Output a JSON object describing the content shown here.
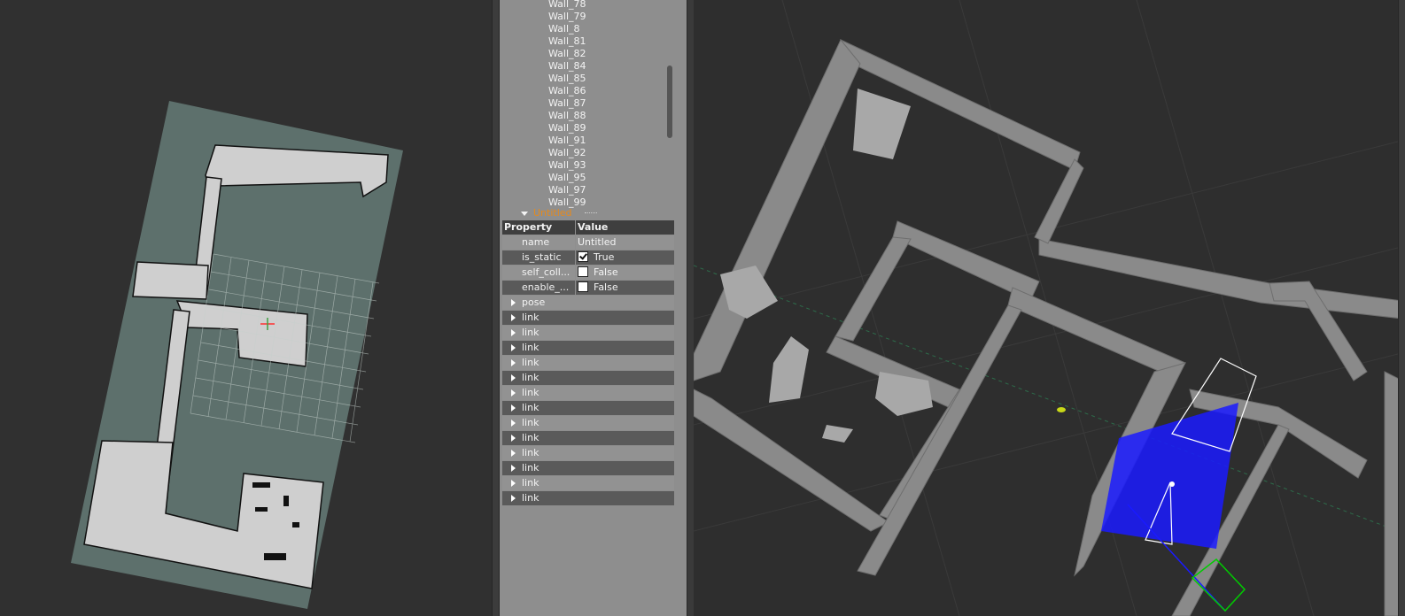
{
  "tree": {
    "walls": [
      "Wall_78",
      "Wall_79",
      "Wall_8",
      "Wall_81",
      "Wall_82",
      "Wall_84",
      "Wall_85",
      "Wall_86",
      "Wall_87",
      "Wall_88",
      "Wall_89",
      "Wall_91",
      "Wall_92",
      "Wall_93",
      "Wall_95",
      "Wall_97",
      "Wall_99"
    ],
    "model_label": "Untitled"
  },
  "properties": {
    "header_property": "Property",
    "header_value": "Value",
    "rows": [
      {
        "name": "name",
        "value": "Untitled",
        "checkbox": false
      },
      {
        "name": "is_static",
        "value": "True",
        "checkbox": true,
        "checked": true
      },
      {
        "name": "self_coll...",
        "value": "False",
        "checkbox": true,
        "checked": false
      },
      {
        "name": "enable_...",
        "value": "False",
        "checkbox": true,
        "checked": false
      }
    ],
    "groups": [
      "pose",
      "link",
      "link",
      "link",
      "link",
      "link",
      "link",
      "link",
      "link",
      "link",
      "link",
      "link",
      "link",
      "link"
    ]
  },
  "colors": {
    "model_label": "#e58a1e",
    "map_background": "#5d706c",
    "map_free_space": "#cfcfcf",
    "robot_footprint": "#1a1aff",
    "goal_box": "#00cc00"
  },
  "icons": {
    "expand": "triangle-right-icon",
    "collapse": "triangle-down-icon",
    "checkbox": "checkbox-icon"
  }
}
